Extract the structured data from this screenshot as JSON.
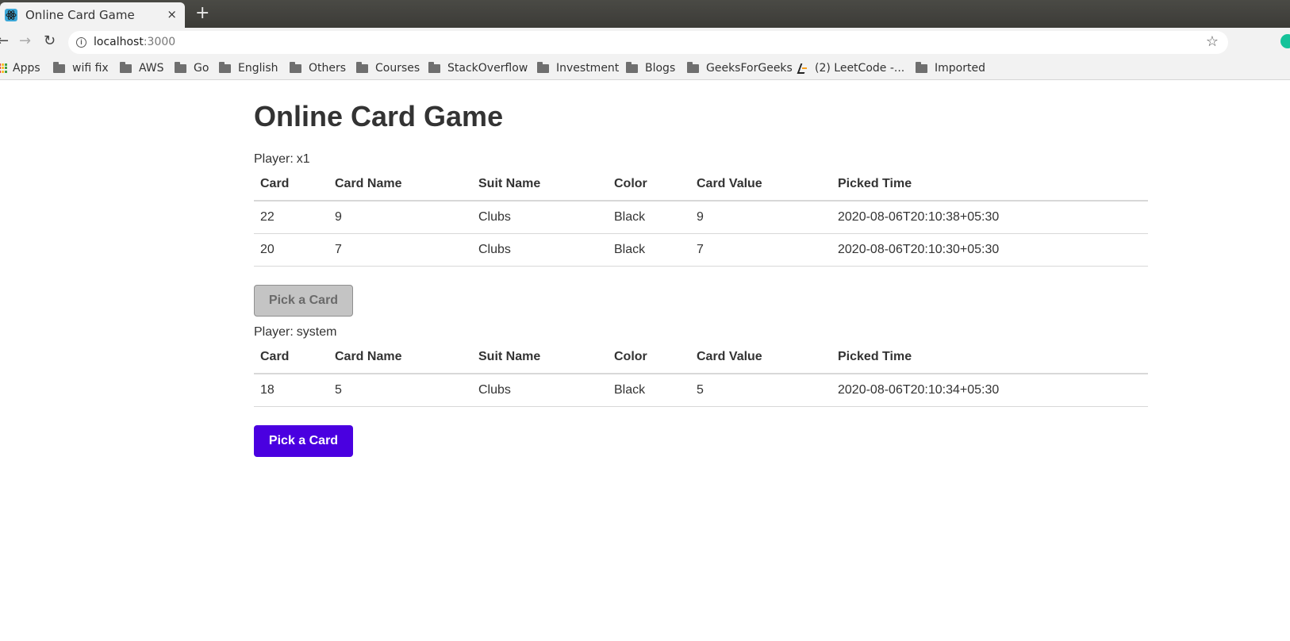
{
  "browser": {
    "tab_title": "Online Card Game",
    "tab_close": "×",
    "new_tab": "+",
    "url_host": "localhost",
    "url_port": ":3000",
    "bookmarks": [
      {
        "label": "Apps",
        "icon": "apps-icon"
      },
      {
        "label": "wifi fix",
        "icon": "folder-icon"
      },
      {
        "label": "AWS",
        "icon": "folder-icon"
      },
      {
        "label": "Go",
        "icon": "folder-icon"
      },
      {
        "label": "English",
        "icon": "folder-icon"
      },
      {
        "label": "Others",
        "icon": "folder-icon"
      },
      {
        "label": "Courses",
        "icon": "folder-icon"
      },
      {
        "label": "StackOverflow",
        "icon": "folder-icon"
      },
      {
        "label": "Investment",
        "icon": "folder-icon"
      },
      {
        "label": "Blogs",
        "icon": "folder-icon"
      },
      {
        "label": "GeeksForGeeks",
        "icon": "folder-icon"
      },
      {
        "label": "(2) LeetCode -...",
        "icon": "leetcode-icon"
      },
      {
        "label": "Imported",
        "icon": "folder-icon"
      }
    ]
  },
  "page": {
    "title": "Online Card Game",
    "player_prefix": "Player:",
    "columns": [
      "Card",
      "Card Name",
      "Suit Name",
      "Color",
      "Card Value",
      "Picked Time"
    ],
    "players": [
      {
        "name": "x1",
        "rows": [
          [
            "22",
            "9",
            "Clubs",
            "Black",
            "9",
            "2020-08-06T20:10:38+05:30"
          ],
          [
            "20",
            "7",
            "Clubs",
            "Black",
            "7",
            "2020-08-06T20:10:30+05:30"
          ]
        ],
        "button_label": "Pick a Card",
        "button_state": "disabled"
      },
      {
        "name": "system",
        "rows": [
          [
            "18",
            "5",
            "Clubs",
            "Black",
            "5",
            "2020-08-06T20:10:34+05:30"
          ]
        ],
        "button_label": "Pick a Card",
        "button_state": "active"
      }
    ]
  },
  "colors": {
    "primary_button": "#4a00e0",
    "disabled_button": "#c4c4c4"
  }
}
